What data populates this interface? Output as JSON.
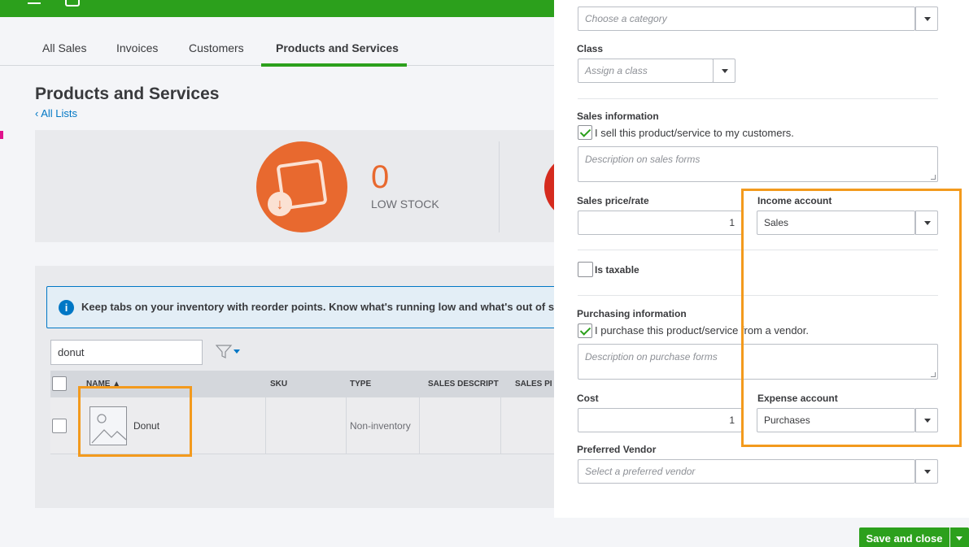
{
  "tabs": [
    {
      "label": "All Sales"
    },
    {
      "label": "Invoices"
    },
    {
      "label": "Customers"
    },
    {
      "label": "Products and Services"
    }
  ],
  "page": {
    "title": "Products and Services",
    "back_link": "All Lists"
  },
  "stock": {
    "low_stock_count": "0",
    "low_stock_label": "LOW STOCK"
  },
  "banner": {
    "text": "Keep tabs on your inventory with reorder points. Know what's running low and what's out of sto"
  },
  "search": {
    "value": "donut"
  },
  "table": {
    "columns": [
      "NAME ▲",
      "SKU",
      "TYPE",
      "SALES DESCRIPT",
      "SALES PI"
    ],
    "rows": [
      {
        "name": "Donut",
        "sku": "",
        "type": "Non-inventory"
      }
    ]
  },
  "drawer": {
    "category_placeholder": "Choose a category",
    "class_label": "Class",
    "class_placeholder": "Assign a class",
    "sales_info_label": "Sales information",
    "sell_checkbox_label": "I sell this product/service to my customers.",
    "sales_desc_placeholder": "Description on sales forms",
    "sales_price_label": "Sales price/rate",
    "sales_price_value": "1",
    "income_account_label": "Income account",
    "income_account_value": "Sales",
    "taxable_label": "Is taxable",
    "purchasing_info_label": "Purchasing information",
    "purchase_checkbox_label": "I purchase this product/service from a vendor.",
    "purchase_desc_placeholder": "Description on purchase forms",
    "cost_label": "Cost",
    "cost_value": "1",
    "expense_account_label": "Expense account",
    "expense_account_value": "Purchases",
    "vendor_label": "Preferred Vendor",
    "vendor_placeholder": "Select a preferred vendor",
    "save_label": "Save and close"
  },
  "colors": {
    "brand_green": "#2ca01c",
    "highlight_orange": "#f39a1d",
    "stock_orange": "#e8692f",
    "link_blue": "#0077c5"
  }
}
